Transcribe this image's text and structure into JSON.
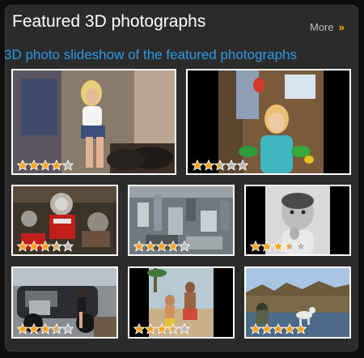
{
  "widget": {
    "title": "Featured 3D photographs",
    "more_label": "More",
    "more_chevron": "»",
    "subtitle": "3D photo slideshow of the featured photographs"
  },
  "colors": {
    "accent_blue": "#2e9ae8",
    "star_gold": "#f6a21e",
    "star_empty": "#b9b9b9",
    "chevron": "#f5b800"
  },
  "photos": [
    {
      "name": "photo-woman-sitting",
      "rating": 4
    },
    {
      "name": "photo-girl-with-parrots",
      "rating": 2.5
    },
    {
      "name": "photo-engine-machinery",
      "rating": 3.5
    },
    {
      "name": "photo-city-aerial",
      "rating": 4
    },
    {
      "name": "photo-baby-portrait",
      "rating": 3.5
    },
    {
      "name": "photo-car-and-woman",
      "rating": 3.5
    },
    {
      "name": "photo-beach-people",
      "rating": 3.5
    },
    {
      "name": "photo-dog-by-river",
      "rating": 5
    }
  ]
}
